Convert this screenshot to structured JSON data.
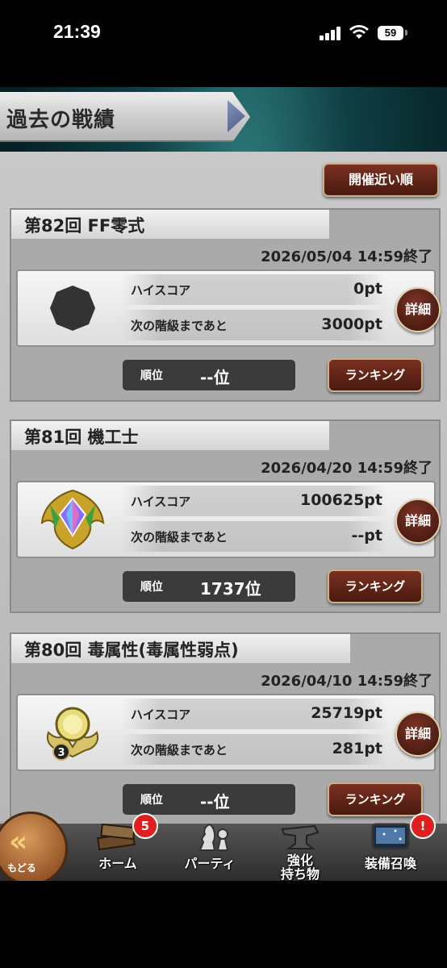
{
  "status_bar": {
    "time": "21:39",
    "battery": "59"
  },
  "header": {
    "title": "過去の戦績"
  },
  "sort_button": "開催近い順",
  "events": [
    {
      "title": "第82回 FF零式",
      "date": "2026/05/04 14:59終了",
      "high_score_label": "ハイスコア",
      "high_score": "0pt",
      "next_label": "次の階級まであと",
      "next_value": "3000pt",
      "detail_label": "詳細",
      "rank_label": "順位",
      "rank_value": "--位",
      "ranking_button": "ランキング"
    },
    {
      "title": "第81回 機工士",
      "date": "2026/04/20 14:59終了",
      "high_score_label": "ハイスコア",
      "high_score": "100625pt",
      "next_label": "次の階級まであと",
      "next_value": "--pt",
      "detail_label": "詳細",
      "rank_label": "順位",
      "rank_value": "1737位",
      "ranking_button": "ランキング"
    },
    {
      "title": "第80回 毒属性(毒属性弱点)",
      "date": "2026/04/10 14:59終了",
      "high_score_label": "ハイスコア",
      "high_score": "25719pt",
      "next_label": "次の階級まであと",
      "next_value": "281pt",
      "detail_label": "詳細",
      "rank_label": "順位",
      "rank_value": "--位",
      "ranking_button": "ランキング",
      "emblem_number": "3"
    }
  ],
  "bottom_nav": {
    "back_label": "もどる",
    "items": [
      {
        "label": "ホーム",
        "badge": "5"
      },
      {
        "label": "パーティ"
      },
      {
        "label": "強化\n持ち物"
      },
      {
        "label": "装備召喚",
        "badge": "!"
      }
    ]
  }
}
